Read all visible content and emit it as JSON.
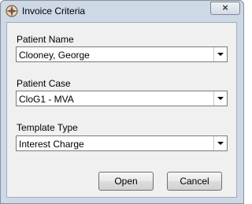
{
  "window": {
    "title": "Invoice Criteria",
    "close_label": "×"
  },
  "form": {
    "patient_name_label": "Patient Name",
    "patient_name_value": "Clooney, George",
    "patient_case_label": "Patient Case",
    "patient_case_value": "CloG1 - MVA",
    "template_type_label": "Template Type",
    "template_type_value": "Interest Charge"
  },
  "buttons": {
    "open_label": "Open",
    "cancel_label": "Cancel"
  }
}
